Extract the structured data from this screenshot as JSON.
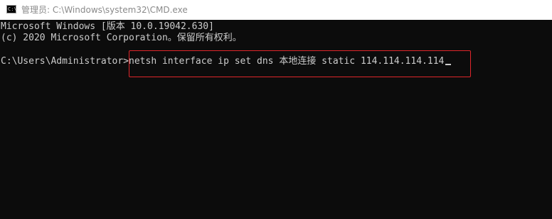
{
  "window": {
    "title": "管理员: C:\\Windows\\system32\\CMD.exe",
    "icon": "cmd-console-icon"
  },
  "console": {
    "lines": [
      "Microsoft Windows [版本 10.0.19042.630]",
      "(c) 2020 Microsoft Corporation。保留所有权利。"
    ],
    "prompt": "C:\\Users\\Administrator>",
    "command": "netsh interface ip set dns 本地连接 static 114.114.114.114"
  },
  "colors": {
    "background": "#0c0c0c",
    "text": "#cccccc",
    "highlight_border": "#e0262b",
    "titlebar": "#ffffff"
  }
}
